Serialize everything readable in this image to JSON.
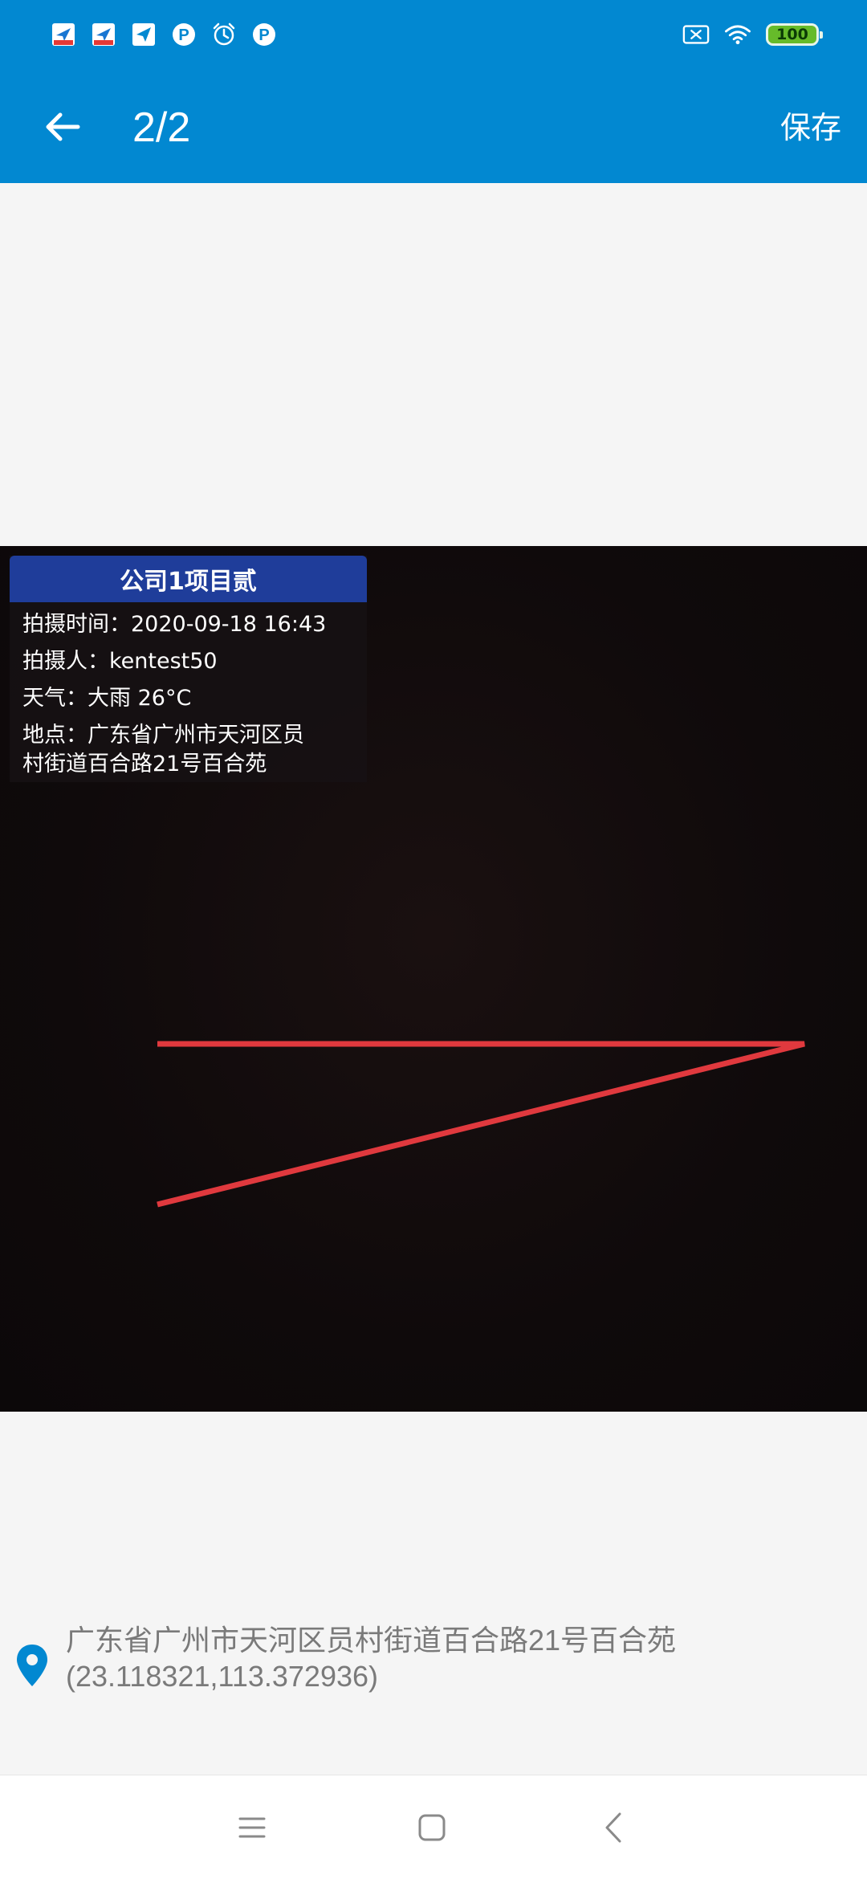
{
  "status_bar": {
    "battery_level": "100",
    "left_icons": [
      "notification-app-icon",
      "notification-app-icon",
      "send-icon",
      "parking-icon",
      "alarm-icon",
      "parking-icon"
    ],
    "right_icons": [
      "sim-missing-icon",
      "wifi-icon",
      "battery-icon"
    ]
  },
  "app_bar": {
    "title": "2/2",
    "save_label": "保存",
    "background": "#0288d1"
  },
  "watermark": {
    "header": "公司1项目贰",
    "time_line": "拍摄时间：2020-09-18 16:43",
    "photographer_line": "拍摄人：kentest50",
    "weather_line": "天气：大雨 26°C",
    "address_line1": "地点：广东省广州市天河区员",
    "address_line2": "村街道百合路21号百合苑",
    "header_color": "#1f3d9a"
  },
  "annotation": {
    "stroke_color": "#e0393e"
  },
  "location": {
    "address": "广东省广州市天河区员村街道百合路21号百合苑",
    "coordinates": "(23.118321,113.372936)",
    "pin_color": "#0288d1"
  },
  "nav_bar": {
    "buttons": [
      "menu-icon",
      "home-icon",
      "back-icon"
    ]
  }
}
